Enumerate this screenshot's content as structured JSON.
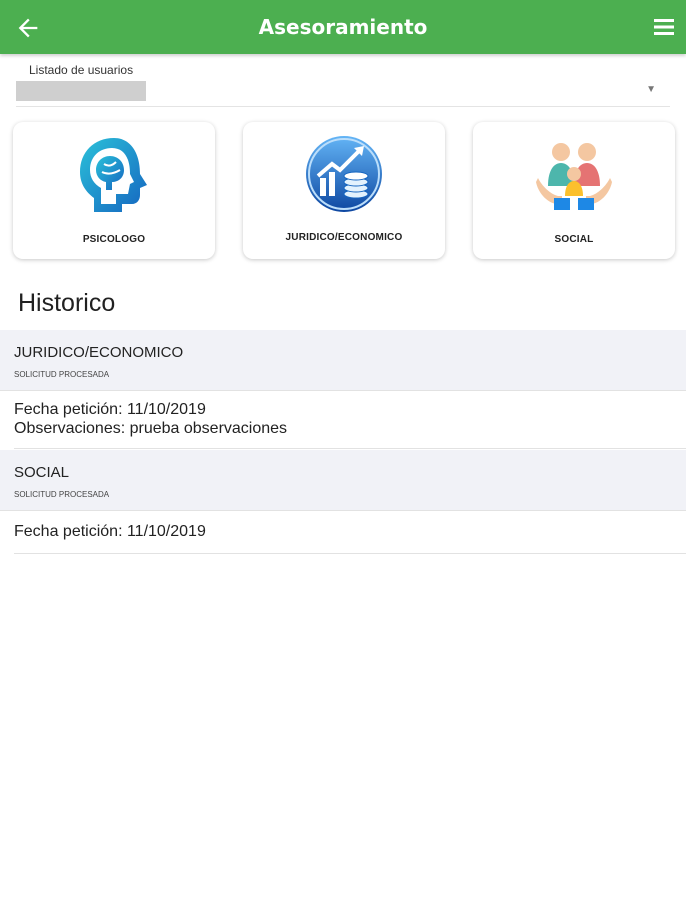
{
  "appbar": {
    "title": "Asesoramiento",
    "icons": {
      "back": "arrow-left-icon",
      "menu": "hamburger-menu-icon"
    },
    "color": "#4caf50"
  },
  "user_select": {
    "label": "Listado de usuarios",
    "value": "",
    "icon": "dropdown-arrow-icon"
  },
  "categories": [
    {
      "label": "PSICOLOGO",
      "icon": "brain-head-icon"
    },
    {
      "label": "JURIDICO/ECONOMICO",
      "icon": "growth-coins-icon"
    },
    {
      "label": "SOCIAL",
      "icon": "family-hands-icon"
    }
  ],
  "historico": {
    "title": "Historico",
    "entries": [
      {
        "category": "JURIDICO/ECONOMICO",
        "status": "SOLICITUD PROCESADA",
        "fecha": "Fecha petición: 11/10/2019",
        "observaciones": "Observaciones: prueba observaciones"
      },
      {
        "category": "SOCIAL",
        "status": "SOLICITUD PROCESADA",
        "fecha": "Fecha petición: 11/10/2019"
      }
    ]
  }
}
